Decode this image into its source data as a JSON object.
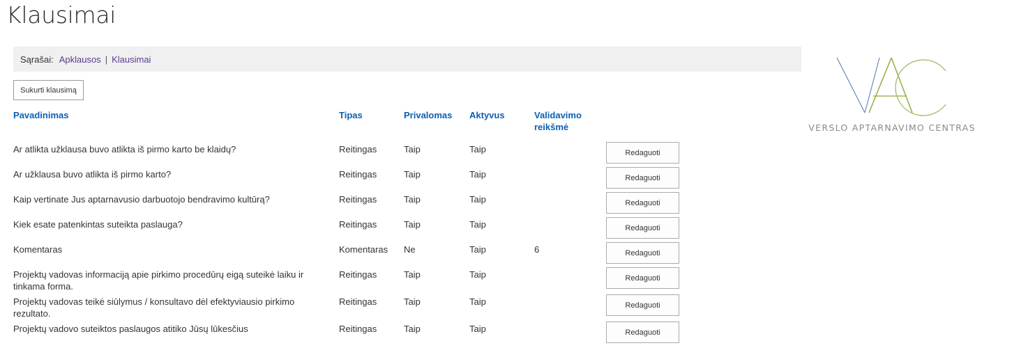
{
  "page": {
    "title": "Klausimai"
  },
  "breadcrumb": {
    "label": "Sąrašai:",
    "links": [
      "Apklausos",
      "Klausimai"
    ],
    "separator": "|"
  },
  "actions": {
    "create_label": "Sukurti klausimą"
  },
  "table": {
    "headers": {
      "name": "Pavadinimas",
      "type": "Tipas",
      "required": "Privalomas",
      "active": "Aktyvus",
      "validation_line1": "Validavimo",
      "validation_line2": "reikšmė"
    },
    "edit_label": "Redaguoti",
    "rows": [
      {
        "name_lines": [
          "Ar atlikta užklausa buvo atlikta iš pirmo karto be klaidų?"
        ],
        "type": "Reitingas",
        "required": "Taip",
        "active": "Taip",
        "validation": ""
      },
      {
        "name_lines": [
          "Ar užklausa buvo atlikta iš pirmo karto?"
        ],
        "type": "Reitingas",
        "required": "Taip",
        "active": "Taip",
        "validation": ""
      },
      {
        "name_lines": [
          "Kaip vertinate Jus aptarnavusio darbuotojo bendravimo kultūrą?"
        ],
        "type": "Reitingas",
        "required": "Taip",
        "active": "Taip",
        "validation": ""
      },
      {
        "name_lines": [
          "Kiek esate patenkintas suteikta paslauga?"
        ],
        "type": "Reitingas",
        "required": "Taip",
        "active": "Taip",
        "validation": ""
      },
      {
        "name_lines": [
          "Komentaras"
        ],
        "type": "Komentaras",
        "required": "Ne",
        "active": "Taip",
        "validation": "6"
      },
      {
        "name_lines": [
          "Projektų vadovas informaciją apie pirkimo procedūrų eigą suteikė laiku ir",
          "tinkama forma."
        ],
        "type": "Reitingas",
        "required": "Taip",
        "active": "Taip",
        "validation": ""
      },
      {
        "name_lines": [
          "Projektų vadovas teikė siūlymus / konsultavo dėl efektyviausio pirkimo",
          "rezultato."
        ],
        "type": "Reitingas",
        "required": "Taip",
        "active": "Taip",
        "validation": ""
      },
      {
        "name_lines": [
          "Projektų vadovo suteiktos paslaugos atitiko Jūsų lūkesčius"
        ],
        "type": "Reitingas",
        "required": "Taip",
        "active": "Taip",
        "validation": ""
      }
    ]
  },
  "logo": {
    "letters": "VAC",
    "text": "VERSLO APTARNAVIMO CENTRAS",
    "colors": {
      "v": "#5577aa",
      "a": "#8aaa3a",
      "c": "#a8c070",
      "text": "#8a8a8a"
    }
  }
}
